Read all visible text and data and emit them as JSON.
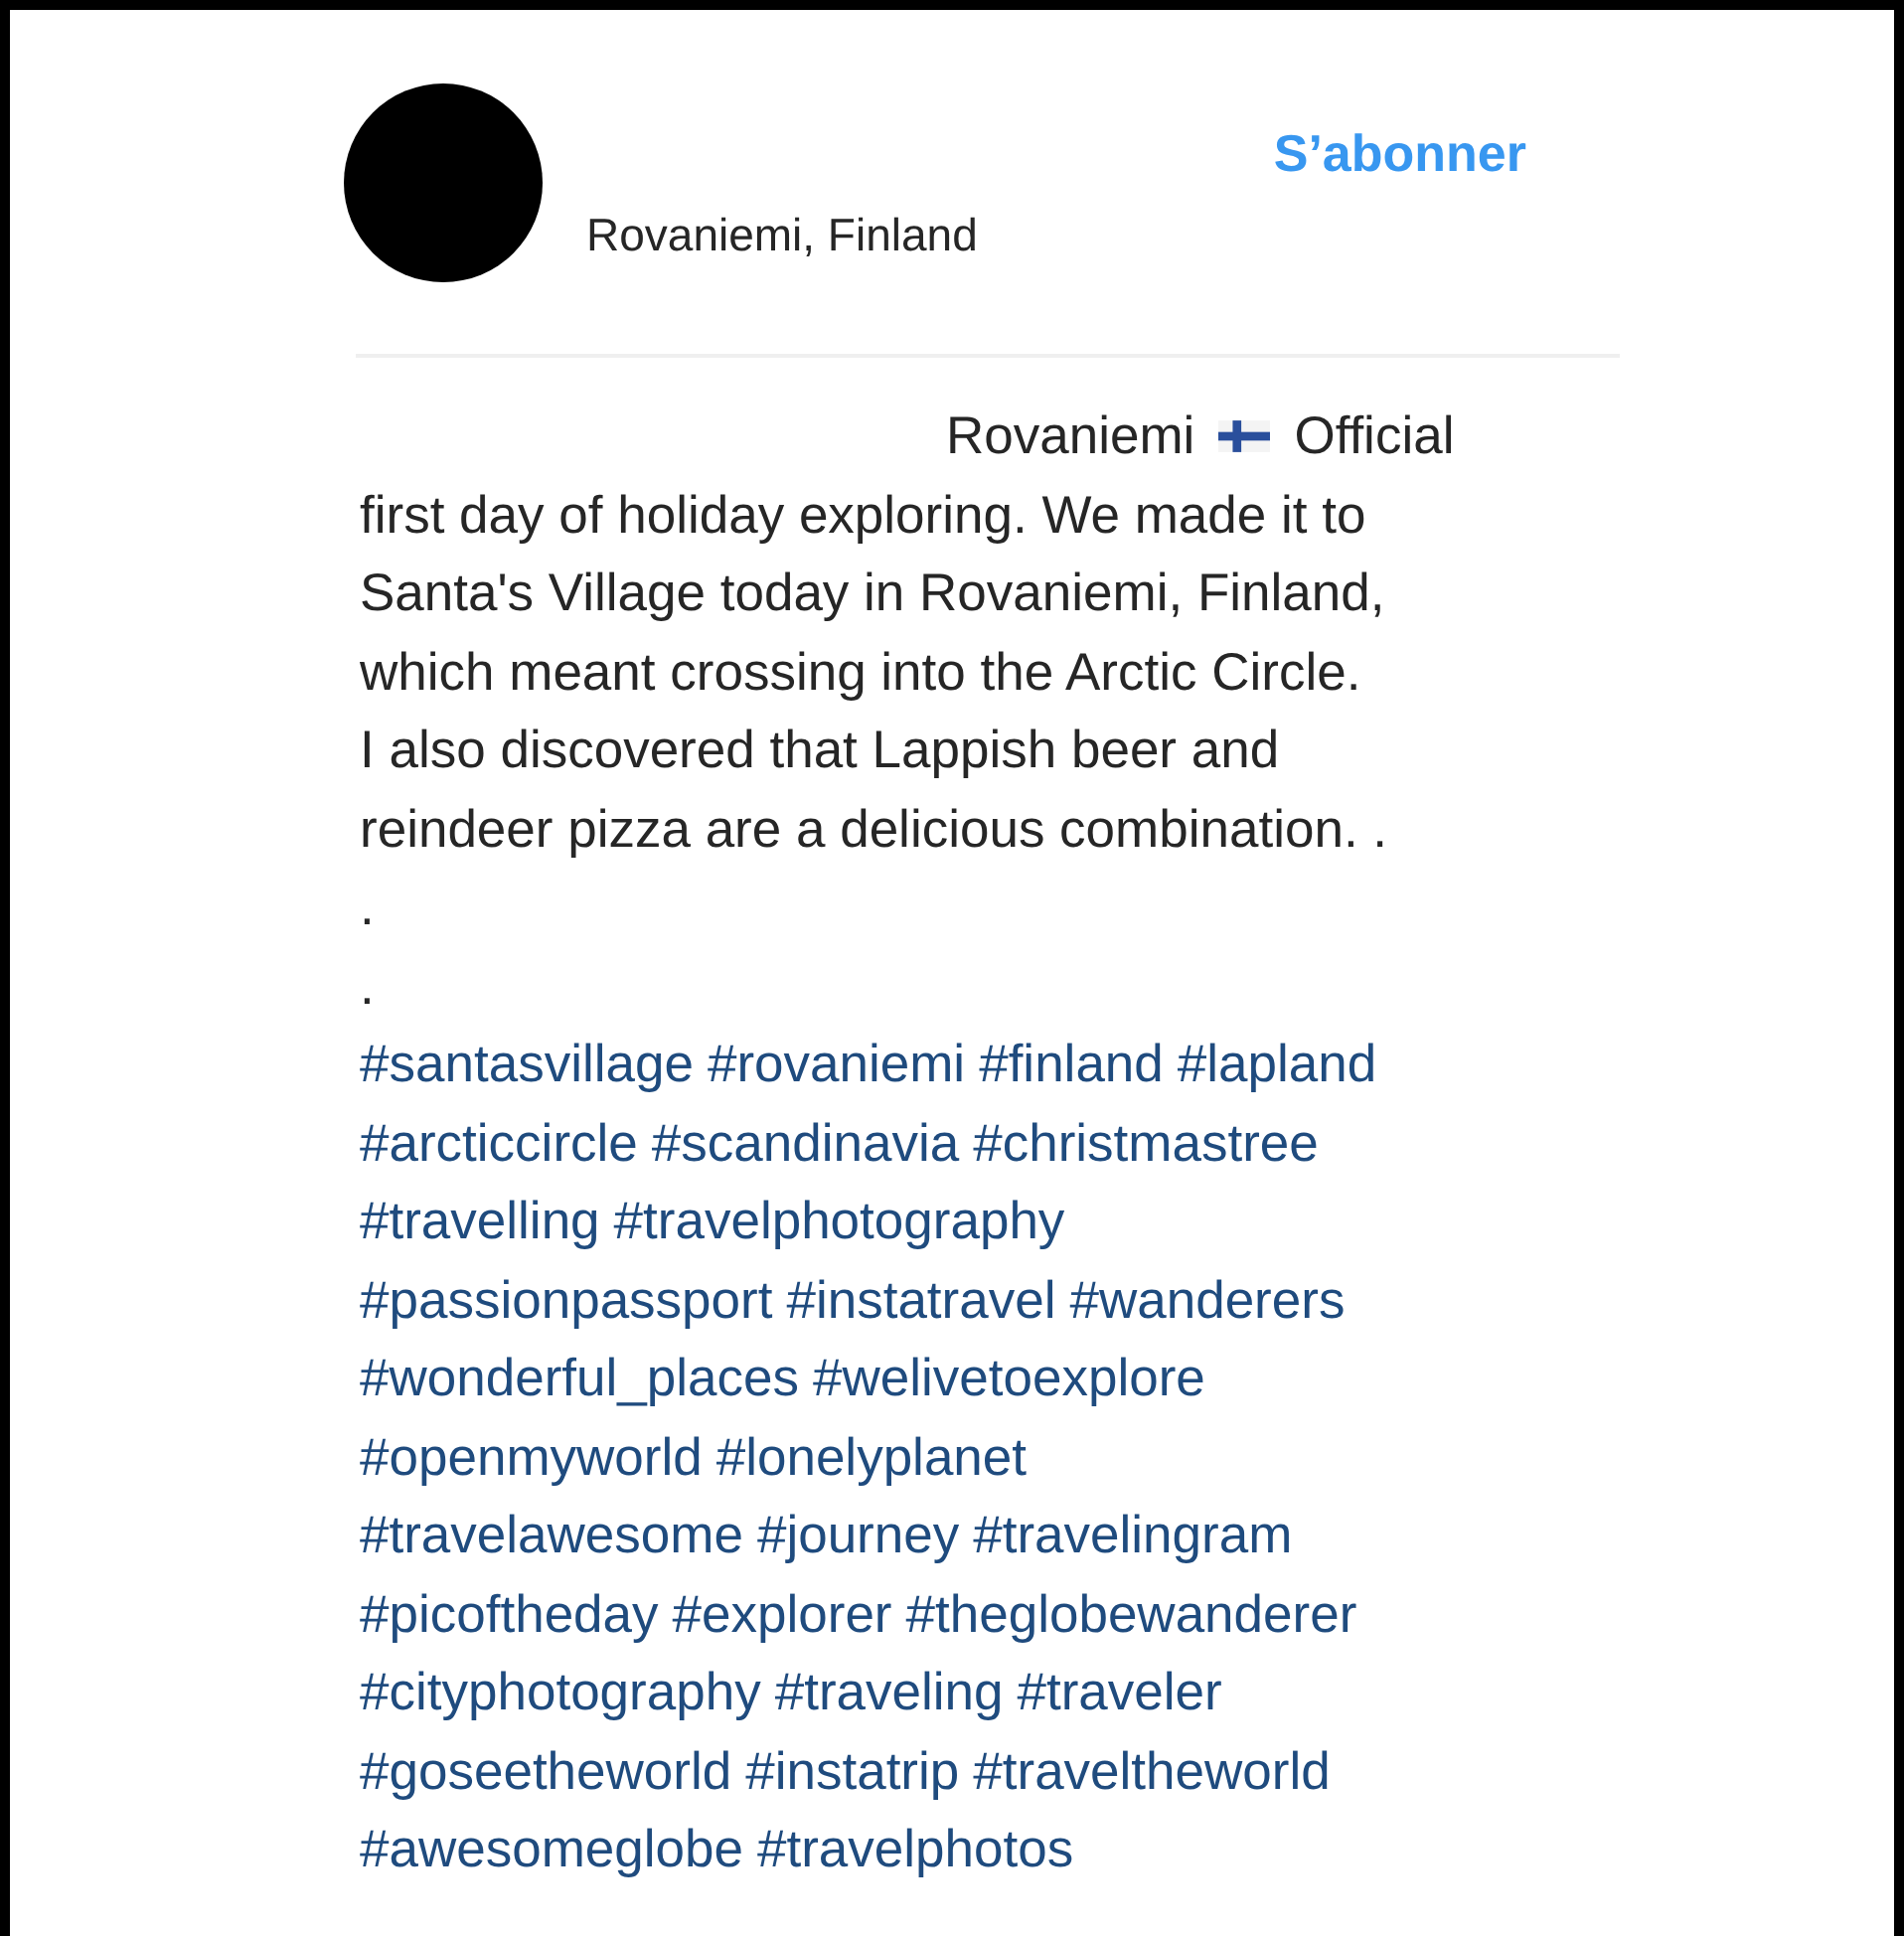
{
  "header": {
    "location": "Rovaniemi, Finland",
    "follow_button": "S’abonner"
  },
  "caption": {
    "intro": [
      "Rovaniemi",
      "Official"
    ],
    "lines": [
      "first day of holiday exploring. We made it to",
      "Santa's Village today in Rovaniemi, Finland,",
      "which meant crossing into the Arctic Circle.",
      "I also discovered that Lappish beer and",
      "reindeer pizza are a delicious combination. .",
      ".",
      "."
    ],
    "hashtag_lines": [
      [
        "#santasvillage",
        "#rovaniemi",
        "#finland",
        "#lapland"
      ],
      [
        "#arcticcircle",
        "#scandinavia",
        "#christmastree"
      ],
      [
        "#travelling",
        "#travelphotography"
      ],
      [
        "#passionpassport",
        "#instatravel",
        "#wanderers"
      ],
      [
        "#wonderful_places",
        "#welivetoexplore"
      ],
      [
        "#openmyworld",
        "#lonelyplanet"
      ],
      [
        "#travelawesome",
        "#journey",
        "#travelingram"
      ],
      [
        "#picoftheday",
        "#explorer",
        "#theglobewanderer"
      ],
      [
        "#cityphotography",
        "#traveling",
        "#traveler"
      ],
      [
        "#goseetheworld",
        "#instatrip",
        "#traveltheworld"
      ],
      [
        "#awesomeglobe",
        "#travelphotos"
      ]
    ]
  }
}
